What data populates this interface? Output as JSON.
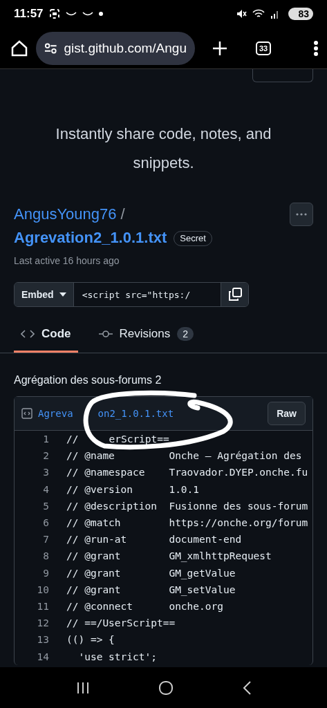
{
  "status_bar": {
    "time": "11:57",
    "battery": "83"
  },
  "browser": {
    "url": "gist.github.com/Angu",
    "tab_count": "33"
  },
  "hero": {
    "tagline": "Instantly share code, notes, and snippets."
  },
  "gist": {
    "owner": "AngusYoung76",
    "separator": "/",
    "filename": "Agrevation2_1.0.1.txt",
    "badge": "Secret",
    "last_active": "Last active 16 hours ago"
  },
  "embed": {
    "label": "Embed",
    "value": "<script src=\"https:/"
  },
  "tabs": [
    {
      "label": "Code",
      "kind": "code",
      "selected": true
    },
    {
      "label": "Revisions",
      "kind": "revisions",
      "count": "2",
      "selected": false
    }
  ],
  "description": "Agrégation des sous-forums 2",
  "file": {
    "name_start": "Agreva",
    "name_end": "on2_1.0.1.txt",
    "raw_button": "Raw",
    "lines": [
      {
        "number": "1",
        "text": "//",
        "after_mark": "erScript=="
      },
      {
        "number": "2",
        "text": "// @name         Onche – Agrégation des"
      },
      {
        "number": "3",
        "text": "// @namespace    Traovador.DYEP.onche.fu"
      },
      {
        "number": "4",
        "text": "// @version      1.0.1"
      },
      {
        "number": "5",
        "text": "// @description  Fusionne des sous-forum"
      },
      {
        "number": "6",
        "text": "// @match        https://onche.org/forum"
      },
      {
        "number": "7",
        "text": "// @run-at       document-end"
      },
      {
        "number": "8",
        "text": "// @grant        GM_xmlhttpRequest"
      },
      {
        "number": "9",
        "text": "// @grant        GM_getValue"
      },
      {
        "number": "10",
        "text": "// @grant        GM_setValue"
      },
      {
        "number": "11",
        "text": "// @connect      onche.org"
      },
      {
        "number": "12",
        "text": "// ==/UserScript=="
      },
      {
        "number": "13",
        "text": "(() => {"
      },
      {
        "number": "14",
        "text": "  'use strict';"
      }
    ]
  }
}
